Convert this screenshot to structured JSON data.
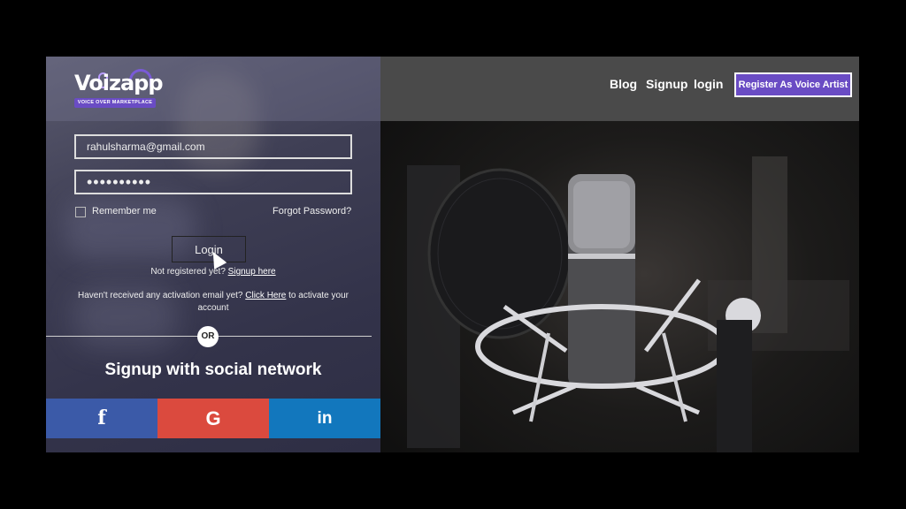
{
  "brand": {
    "logo_text": "Voizapp",
    "tagline": "VOICE OVER MARKETPLACE"
  },
  "nav": {
    "blog": "Blog",
    "signup": "Signup",
    "login": "login",
    "register": "Register As Voice Artist"
  },
  "form": {
    "email_value": "rahulsharma@gmail.com",
    "password_value": "••••••••••",
    "remember_label": "Remember me",
    "forgot_label": "Forgot Password?",
    "login_label": "Login",
    "not_registered": "Not registered yet?",
    "signup_link": "Signup here",
    "activation_prefix": "Haven't received any activation email yet?",
    "activation_link": "Click Here",
    "activation_suffix": "to activate your account"
  },
  "social": {
    "or_label": "OR",
    "title": "Signup with social network",
    "facebook_icon": "f",
    "google_icon": "G",
    "linkedin_icon": "in"
  },
  "colors": {
    "accent": "#6a4cc4",
    "facebook": "#3b5aa8",
    "google": "#db4a3e",
    "linkedin": "#1277bd"
  }
}
